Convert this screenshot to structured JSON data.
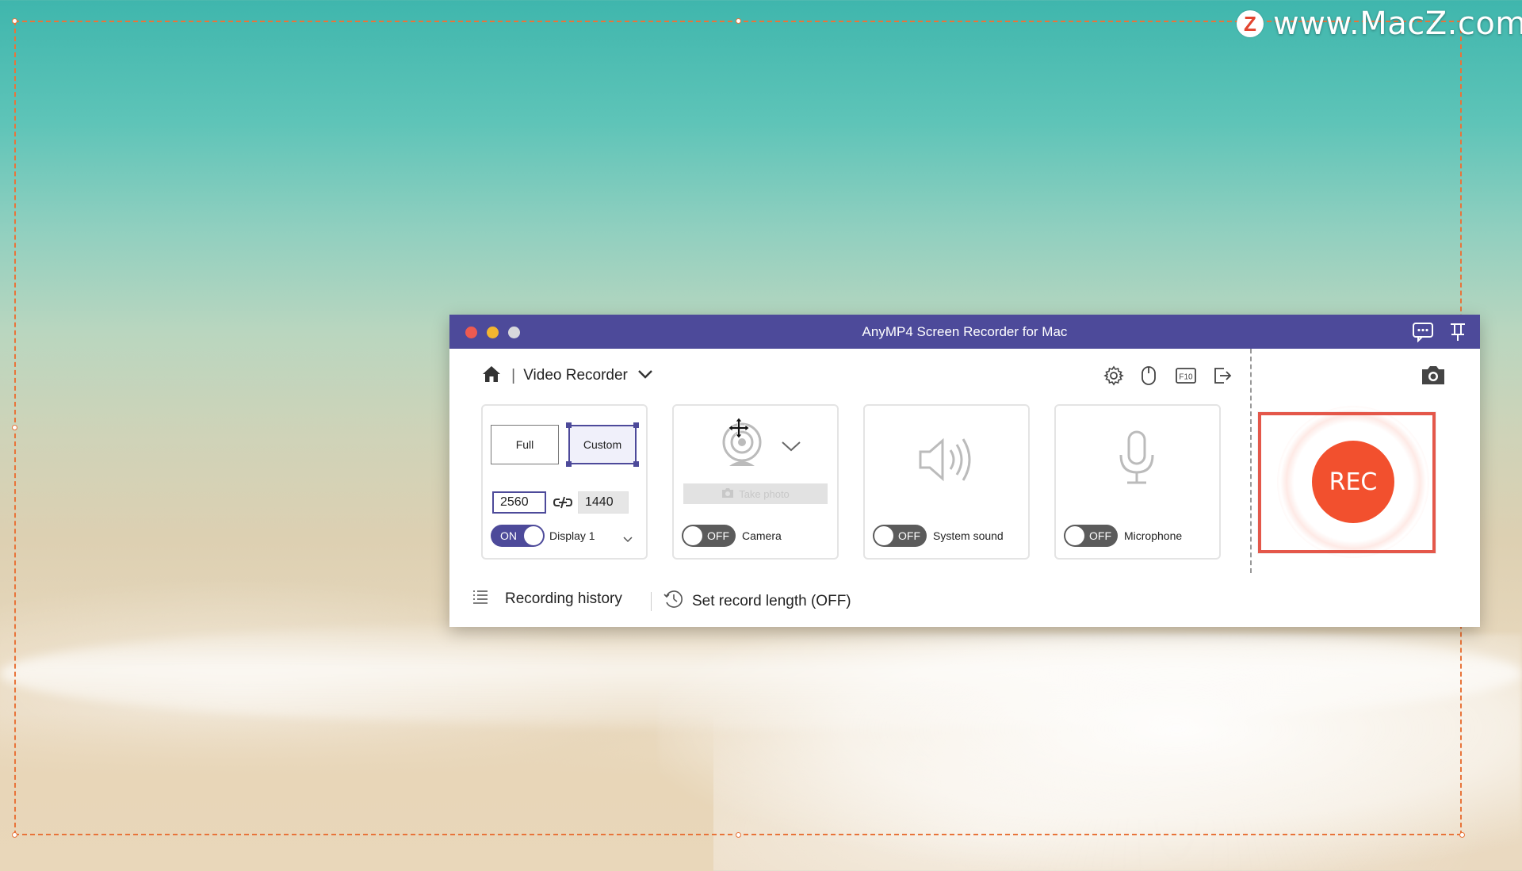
{
  "watermark": {
    "logo_letter": "Z",
    "text": "www.MacZ.com"
  },
  "window": {
    "title": "AnyMP4 Screen Recorder for Mac"
  },
  "nav": {
    "mode_label": "Video Recorder"
  },
  "area": {
    "full_label": "Full",
    "custom_label": "Custom",
    "width": "2560",
    "height": "1440",
    "display_toggle": "ON",
    "display_label": "Display 1"
  },
  "camera": {
    "take_photo_label": "Take photo",
    "toggle": "OFF",
    "label": "Camera"
  },
  "system_sound": {
    "toggle": "OFF",
    "label": "System sound"
  },
  "microphone": {
    "toggle": "OFF",
    "label": "Microphone"
  },
  "rec": {
    "label": "REC"
  },
  "bottom": {
    "history_label": "Recording history",
    "record_length_label": "Set record length (OFF)"
  },
  "colors": {
    "accent": "#4d4a9a",
    "rec": "#f2502e",
    "highlight_border": "#e4574a",
    "selection": "#e8743a"
  }
}
